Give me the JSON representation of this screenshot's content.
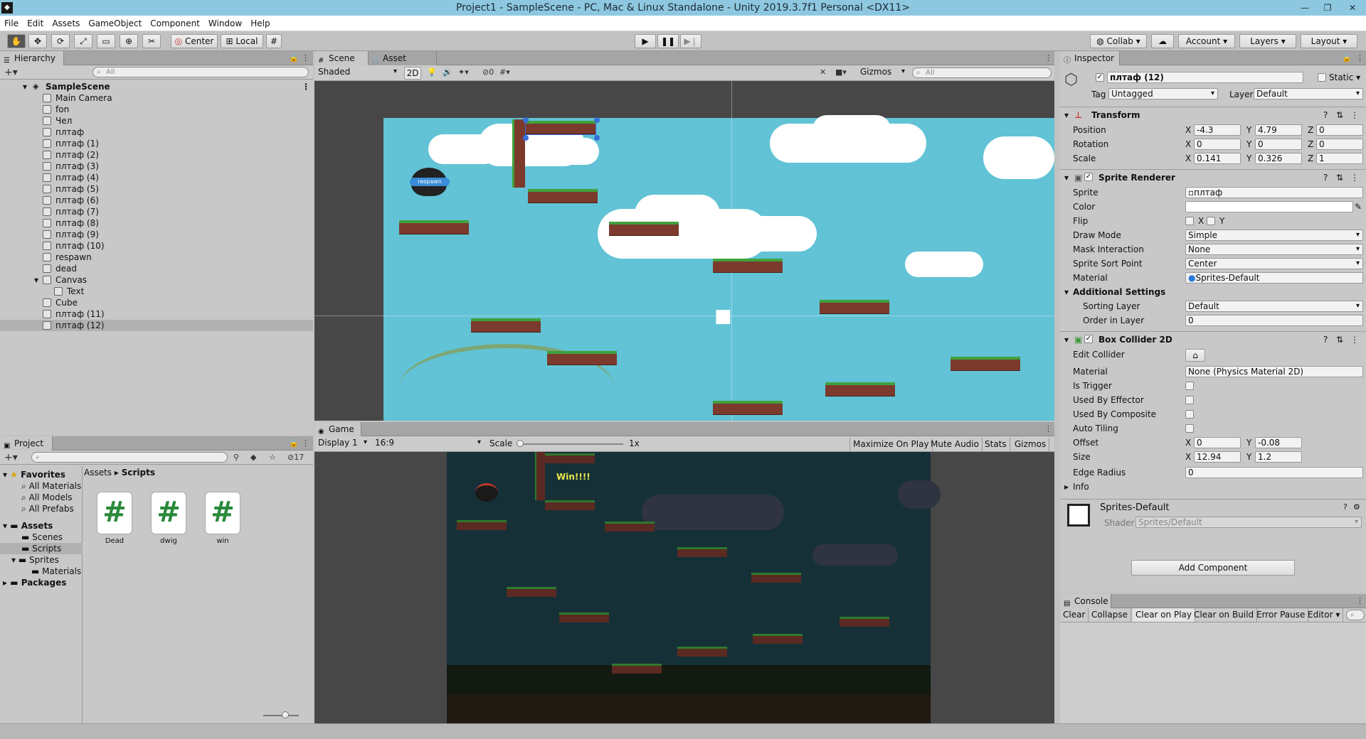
{
  "window": {
    "title": "Project1 - SampleScene - PC, Mac & Linux Standalone - Unity 2019.3.7f1 Personal <DX11>"
  },
  "menu": [
    "File",
    "Edit",
    "Assets",
    "GameObject",
    "Component",
    "Window",
    "Help"
  ],
  "toolbar": {
    "center": "Center",
    "local": "Local",
    "collab": "Collab",
    "account": "Account",
    "layers": "Layers",
    "layout": "Layout"
  },
  "hierarchy": {
    "tab": "Hierarchy",
    "search_placeholder": "All",
    "scene": "SampleScene",
    "items": [
      "Main Camera",
      "fon",
      "Чел",
      "плтаф",
      "плтаф (1)",
      "плтаф (2)",
      "плтаф (3)",
      "плтаф (4)",
      "плтаф (5)",
      "плтаф (6)",
      "плтаф (7)",
      "плтаф (8)",
      "плтаф (9)",
      "плтаф (10)",
      "respawn",
      "dead",
      "Canvas",
      "Text",
      "Cube",
      "плтаф (11)",
      "плтаф (12)"
    ],
    "selected": "плтаф (12)"
  },
  "scene": {
    "tabs": [
      "Scene",
      "Asset Store"
    ],
    "shading": "Shaded",
    "mode_2d": "2D",
    "fx_count": "0",
    "gizmos": "Gizmos",
    "search_placeholder": "All",
    "respawn_label": "respawn"
  },
  "game": {
    "tab": "Game",
    "display": "Display 1",
    "aspect": "16:9",
    "scale_label": "Scale",
    "scale_value": "1x",
    "maximize": "Maximize On Play",
    "mute": "Mute Audio",
    "stats": "Stats",
    "gizmos": "Gizmos",
    "win_text": "Win!!!!"
  },
  "project": {
    "tab": "Project",
    "count": "17",
    "favorites": "Favorites",
    "fav_items": [
      "All Materials",
      "All Models",
      "All Prefabs"
    ],
    "assets": "Assets",
    "asset_folders": [
      "Scenes",
      "Scripts",
      "Sprites",
      "Materials"
    ],
    "packages": "Packages",
    "breadcrumb_root": "Assets",
    "breadcrumb_current": "Scripts",
    "files": [
      "Dead",
      "dwig",
      "win"
    ]
  },
  "inspector": {
    "tab": "Inspector",
    "object_name": "плтаф (12)",
    "static": "Static",
    "tag_label": "Tag",
    "tag": "Untagged",
    "layer_label": "Layer",
    "layer": "Default",
    "transform": {
      "title": "Transform",
      "position_label": "Position",
      "position": [
        "-4.3",
        "4.79",
        "0"
      ],
      "rotation_label": "Rotation",
      "rotation": [
        "0",
        "0",
        "0"
      ],
      "scale_label": "Scale",
      "scale": [
        "0.141",
        "0.326",
        "1"
      ]
    },
    "sprite_renderer": {
      "title": "Sprite Renderer",
      "sprite_label": "Sprite",
      "sprite": "плтаф",
      "color_label": "Color",
      "flip_label": "Flip",
      "draw_mode_label": "Draw Mode",
      "draw_mode": "Simple",
      "mask_label": "Mask Interaction",
      "mask": "None",
      "sort_point_label": "Sprite Sort Point",
      "sort_point": "Center",
      "material_label": "Material",
      "material": "Sprites-Default",
      "additional": "Additional Settings",
      "sorting_layer_label": "Sorting Layer",
      "sorting_layer": "Default",
      "order_label": "Order in Layer",
      "order": "0"
    },
    "box_collider": {
      "title": "Box Collider 2D",
      "edit_label": "Edit Collider",
      "material_label": "Material",
      "material": "None (Physics Material 2D)",
      "is_trigger": "Is Trigger",
      "effector": "Used By Effector",
      "composite": "Used By Composite",
      "auto_tiling": "Auto Tiling",
      "offset_label": "Offset",
      "offset": [
        "0",
        "-0.08"
      ],
      "size_label": "Size",
      "size": [
        "12.94",
        "1.2"
      ],
      "edge_label": "Edge Radius",
      "edge": "0",
      "info": "Info"
    },
    "material_block": {
      "name": "Sprites-Default",
      "shader_label": "Shader",
      "shader": "Sprites/Default"
    },
    "add_component": "Add Component"
  },
  "console": {
    "tab": "Console",
    "buttons": [
      "Clear",
      "Collapse",
      "Clear on Play",
      "Clear on Build",
      "Error Pause",
      "Editor"
    ]
  }
}
